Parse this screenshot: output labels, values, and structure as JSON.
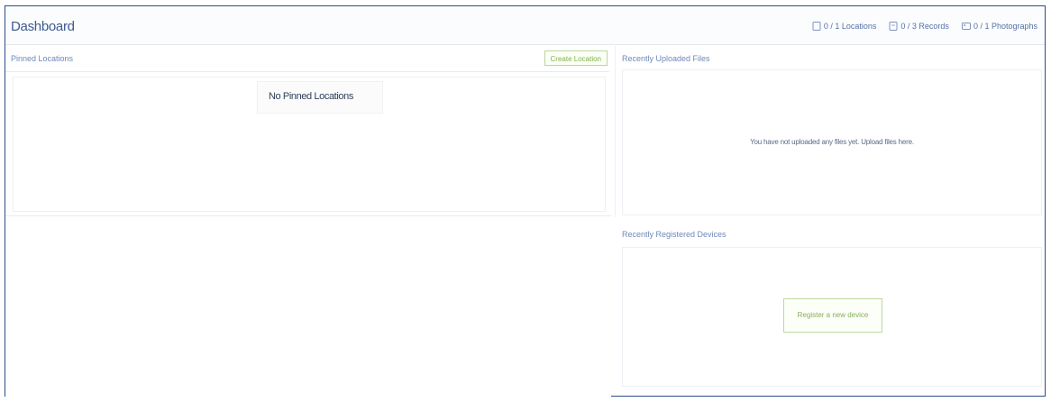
{
  "header": {
    "title": "Dashboard"
  },
  "stats": [
    {
      "icon": "location-icon",
      "label": "0 / 1 Locations"
    },
    {
      "icon": "record-icon",
      "label": "0 / 3 Records"
    },
    {
      "icon": "photo-icon",
      "label": "0 / 1 Photographs"
    }
  ],
  "pinned_locations": {
    "title": "Pinned Locations",
    "create_button": "Create Location",
    "empty_text": "No Pinned Locations"
  },
  "recent_files": {
    "title": "Recently Uploaded Files",
    "empty_text": "You have not uploaded any files yet. Upload files here."
  },
  "recent_devices": {
    "title": "Recently Registered Devices",
    "explore_button": "Register a new device"
  },
  "colors": {
    "frame_border": "#2c4f87",
    "title_blue": "#3d5a8f",
    "accent_green": "#7fb24a"
  }
}
